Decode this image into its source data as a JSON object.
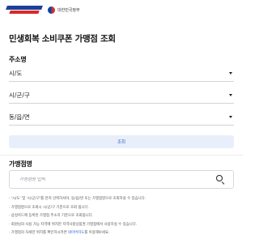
{
  "header": {
    "gov_label": "대한민국정부"
  },
  "page_title": "민생회복 소비쿠폰 가맹점 조회",
  "address": {
    "section_label": "주소명",
    "selects": [
      {
        "label": "시/도"
      },
      {
        "label": "시/군/구"
      },
      {
        "label": "동/읍/면"
      }
    ],
    "search_button": "조회"
  },
  "store": {
    "section_label": "가맹점명",
    "placeholder": "가맹점명 입력",
    "value": ""
  },
  "notes": [
    {
      "text": "'시/도' 및 '시/군/구'를 먼저 선택하셔야, 동/읍/면 또는 가맹점명으로 조회하실 수 있습니다."
    },
    {
      "text": "가맹점명으로 조회시 시/군/구 기준으로 조회 됩니다."
    },
    {
      "text": "삼성카드에 등록된 가맹점 주소지 기준으로 조회됩니다."
    },
    {
      "text": "회원님의 사용 가능 지역에 위치한 지역사랑상품권 가맹점에서 사용하실 수 있습니다."
    },
    {
      "text_before": "가맹점의 자세한 위치를 확인하시려면 ",
      "link": "네이버지도",
      "text_after": "를 이용해보세요."
    }
  ]
}
